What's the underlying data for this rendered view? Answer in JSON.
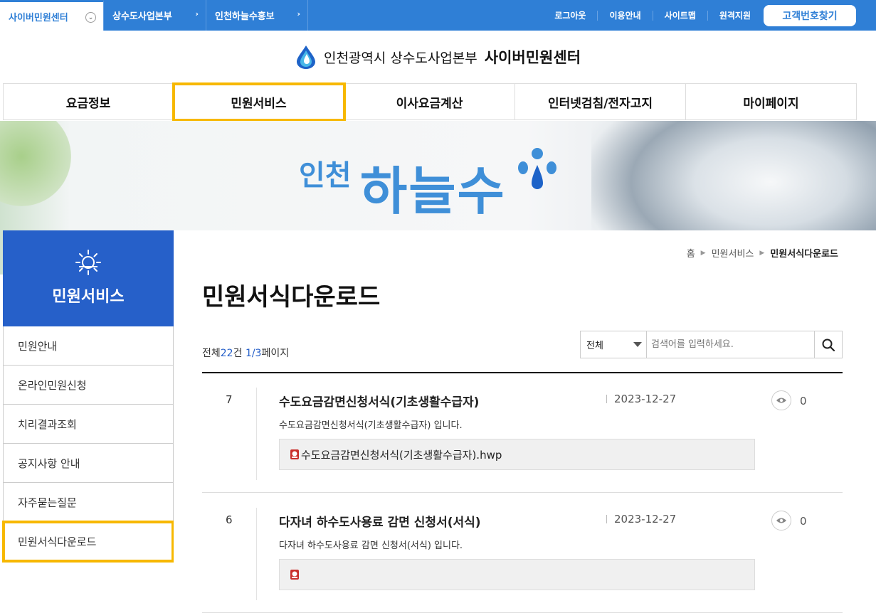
{
  "topbar": {
    "sites": [
      {
        "label": "사이버민원센터",
        "active": true
      },
      {
        "label": "상수도사업본부",
        "active": false
      },
      {
        "label": "인천하늘수홍보",
        "active": false
      }
    ],
    "links": [
      "로그아웃",
      "이용안내",
      "사이트맵",
      "원격지원"
    ],
    "find_button": "고객번호찾기"
  },
  "logo": {
    "org": "인천광역시 상수도사업본부",
    "center": "사이버민원센터"
  },
  "gnb": [
    "요금정보",
    "민원서비스",
    "이사요금계산",
    "인터넷검침/전자고지",
    "마이페이지"
  ],
  "banner": {
    "brand_small": "인천",
    "brand_big": "하늘수"
  },
  "lnb": {
    "title": "민원서비스",
    "items": [
      "민원안내",
      "온라인민원신청",
      "치리결과조회",
      "공지사항 안내",
      "자주묻는질문",
      "민원서식다운로드"
    ]
  },
  "breadcrumb": {
    "home": "홈",
    "parent": "민원서비스",
    "current": "민원서식다운로드"
  },
  "page_title": "민원서식다운로드",
  "count": {
    "prefix": "전체",
    "total": "22",
    "unit": "건 ",
    "page": "1/3",
    "suffix": "페이지"
  },
  "search": {
    "scope": "전체",
    "placeholder": "검색어를 입력하세요."
  },
  "rows": [
    {
      "no": "7",
      "title": "수도요금감면신청서식(기초생활수급자)",
      "date": "2023-12-27",
      "views": "0",
      "desc": "수도요금감면신청서식(기초생활수급자) 입니다.",
      "file": "수도요금감면신청서식(기초생활수급자).hwp"
    },
    {
      "no": "6",
      "title": "다자녀 하수도사용료 감면 신청서(서식)",
      "date": "2023-12-27",
      "views": "0",
      "desc": "다자녀 하수도사용료 감면 신청서(서식) 입니다.",
      "file": ""
    }
  ],
  "colors": {
    "primary": "#2f7fd6",
    "lnb": "#2660c9",
    "highlight": "#f7b800"
  }
}
